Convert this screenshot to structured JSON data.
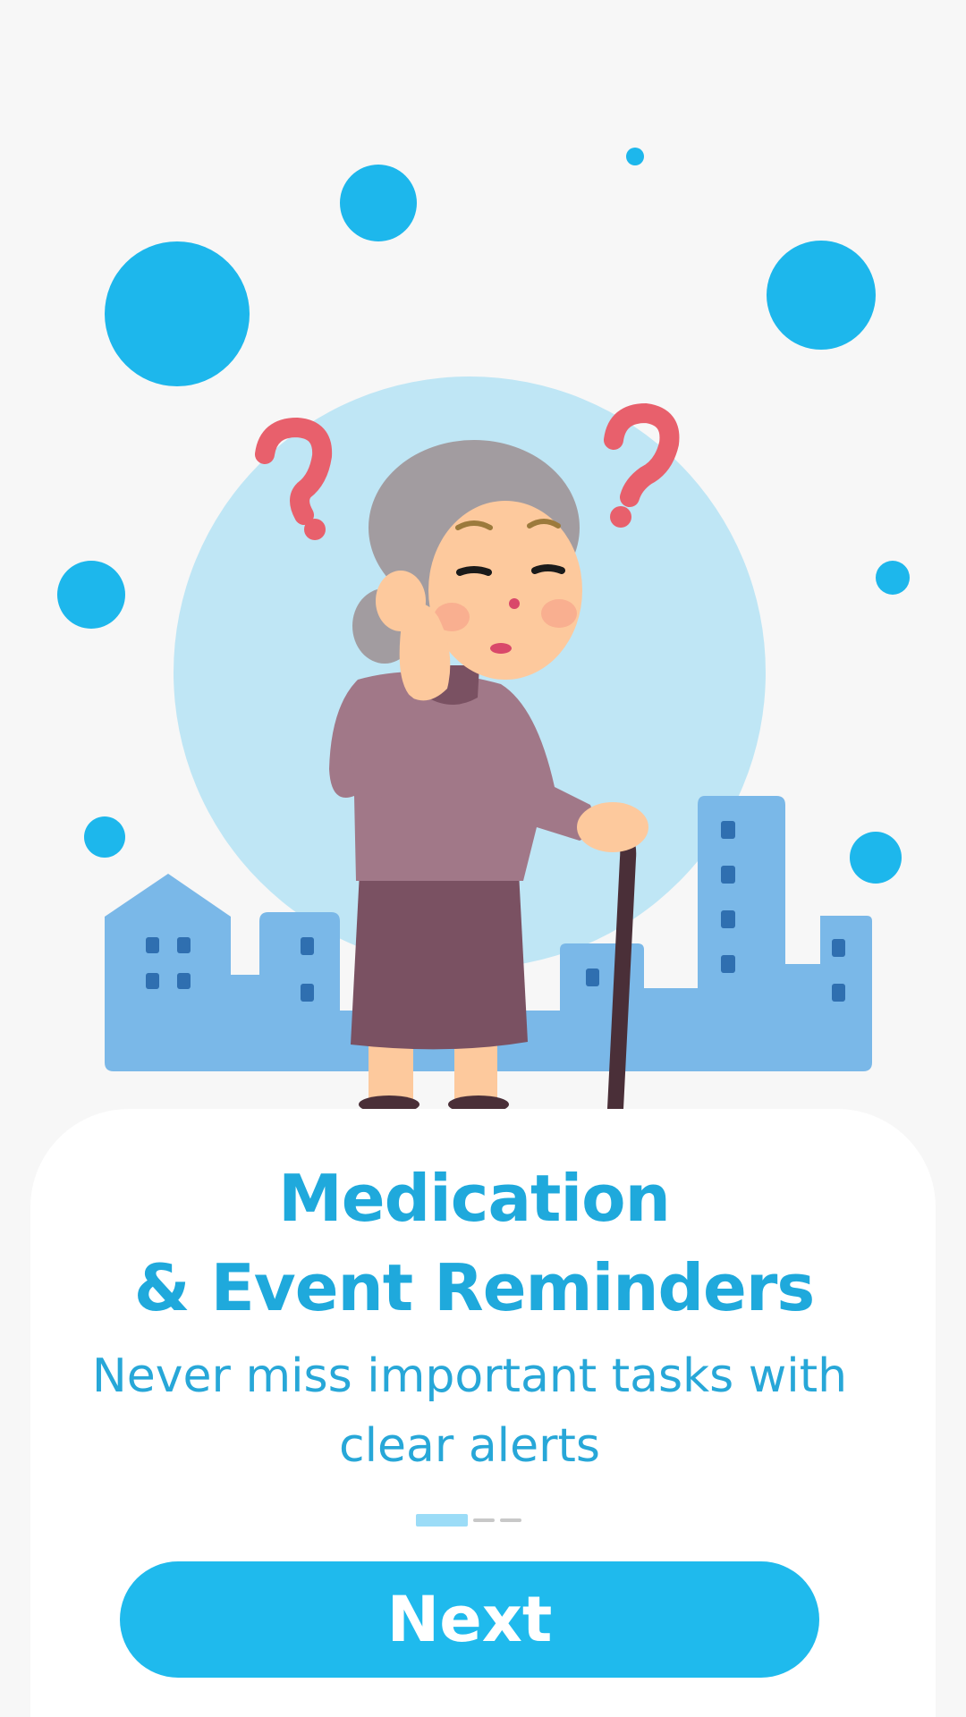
{
  "onboarding": {
    "title_line1": "Medication",
    "title_line2": "& Event Reminders",
    "subtitle": "Never miss important tasks with clear alerts",
    "next_label": "Next",
    "page_index": 1,
    "page_count": 3
  },
  "illustration": {
    "icon": "elderly-woman-confused-illustration",
    "colors": {
      "accent": "#1fbaed",
      "circle_bg": "#bfe6f5",
      "buildings": "#7ab8e8",
      "question_marks": "#e8606c"
    }
  }
}
